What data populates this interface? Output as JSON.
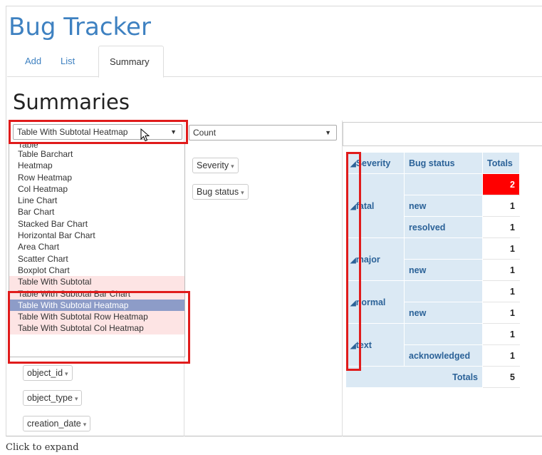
{
  "app": {
    "title": "Bug Tracker"
  },
  "tabs": [
    {
      "label": "Add"
    },
    {
      "label": "List"
    },
    {
      "label": "Summary",
      "active": true
    }
  ],
  "page": {
    "heading": "Summaries"
  },
  "renderer_select": {
    "value": "Table With Subtotal Heatmap",
    "caret": "▼"
  },
  "aggregator_select": {
    "value": "Count",
    "caret": "▼"
  },
  "renderer_options": [
    "Table",
    "Table Barchart",
    "Heatmap",
    "Row Heatmap",
    "Col Heatmap",
    "Line Chart",
    "Bar Chart",
    "Stacked Bar Chart",
    "Horizontal Bar Chart",
    "Area Chart",
    "Scatter Chart",
    "Boxplot Chart",
    "Table With Subtotal",
    "Table With Subtotal Bar Chart",
    "Table With Subtotal Heatmap",
    "Table With Subtotal Row Heatmap",
    "Table With Subtotal Col Heatmap"
  ],
  "selected_option": "Table With Subtotal Heatmap",
  "row_fields": [
    {
      "label": "Severity",
      "arrow": "▾"
    },
    {
      "label": "Bug status",
      "arrow": "▾"
    }
  ],
  "unused_fields": [
    {
      "label": "object_id",
      "arrow": "▾"
    },
    {
      "label": "object_type",
      "arrow": "▾"
    },
    {
      "label": "creation_date",
      "arrow": "▾"
    }
  ],
  "pivot_table": {
    "headers": {
      "severity": "Severity",
      "bug_status": "Bug status",
      "totals": "Totals"
    },
    "collapse_glyph": "◢",
    "grand_total_label": "Totals",
    "grand_total_value": "5",
    "groups": [
      {
        "label": "fatal",
        "subtotal": "2",
        "rows": [
          {
            "status": "new",
            "value": "1"
          },
          {
            "status": "resolved",
            "value": "1"
          }
        ]
      },
      {
        "label": "major",
        "subtotal": "1",
        "rows": [
          {
            "status": "new",
            "value": "1"
          }
        ]
      },
      {
        "label": "normal",
        "subtotal": "1",
        "rows": [
          {
            "status": "new",
            "value": "1"
          }
        ]
      },
      {
        "label": "text",
        "subtotal": "1",
        "rows": [
          {
            "status": "acknowledged",
            "value": "1"
          }
        ]
      }
    ]
  },
  "colors": {
    "accent": "#3e81c1",
    "highlight_red": "#e01b1b",
    "heat": "#ff0000",
    "header_bg": "#dbe9f4"
  },
  "footer": {
    "caption": "Click to expand"
  }
}
